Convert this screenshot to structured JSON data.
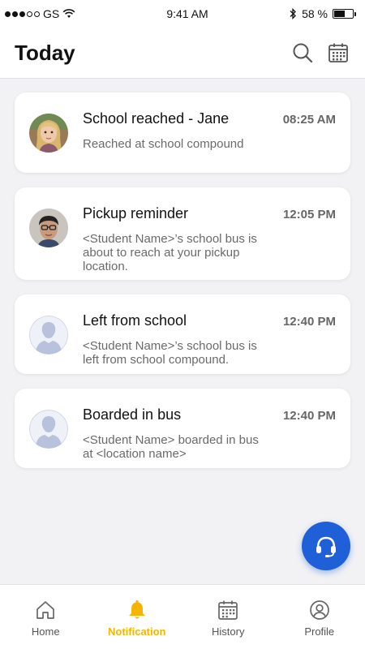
{
  "status_bar": {
    "carrier": "GS",
    "time": "9:41 AM",
    "battery": "58 %",
    "battery_level": 0.58
  },
  "header": {
    "title": "Today"
  },
  "notifications": [
    {
      "title": "School reached - Jane",
      "time": "08:25 AM",
      "description": "Reached at school compound",
      "avatar": "girl-photo"
    },
    {
      "title": "Pickup reminder",
      "time": "12:05 PM",
      "description": "<Student Name>’s school bus is about to reach at your pickup location.",
      "avatar": "boy-photo"
    },
    {
      "title": "Left from school",
      "time": "12:40 PM",
      "description": "<Student Name>’s school bus is left from school compound.",
      "avatar": "placeholder"
    },
    {
      "title": "Boarded in bus",
      "time": "12:40 PM",
      "description": "<Student Name> boarded in bus at <location name>",
      "avatar": "placeholder"
    }
  ],
  "tabs": [
    {
      "label": "Home",
      "icon": "home-icon"
    },
    {
      "label": "Notification",
      "icon": "bell-icon",
      "active": true
    },
    {
      "label": "History",
      "icon": "calendar-icon"
    },
    {
      "label": "Profile",
      "icon": "profile-icon"
    }
  ],
  "colors": {
    "accent": "#f5b400",
    "fab": "#1f5fd8",
    "placeholder_avatar": "#b8c2dc"
  }
}
